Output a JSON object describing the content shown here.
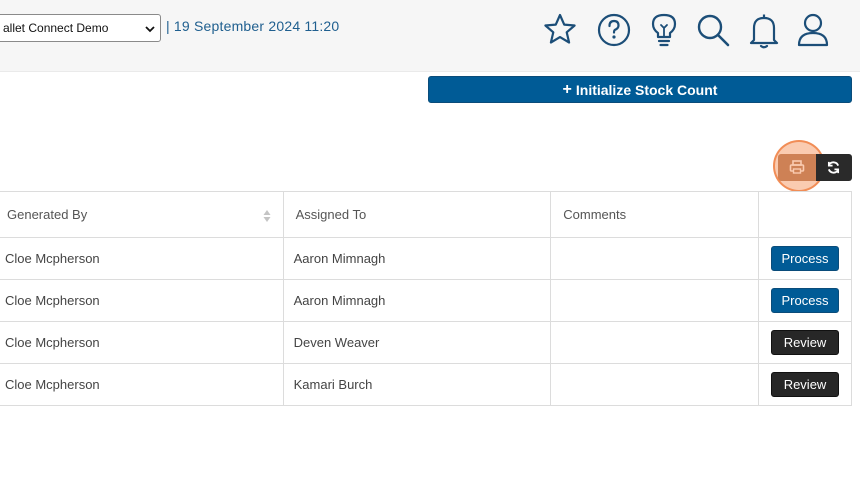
{
  "header": {
    "company_select_value": "allet Connect Demo",
    "datetime": "| 19 September 2024 11:20",
    "icons": [
      "star-icon",
      "help-circle-icon",
      "lightbulb-icon",
      "search-icon",
      "bell-icon",
      "user-icon"
    ]
  },
  "toolbar": {
    "initialize_label": "Initialize Stock Count",
    "print_icon": "print-icon",
    "refresh_icon": "refresh-icon"
  },
  "table": {
    "columns": [
      "Generated By",
      "Assigned To",
      "Comments",
      ""
    ],
    "rows": [
      {
        "generated_by": "Cloe Mcpherson",
        "assigned_to": "Aaron Mimnagh",
        "comments": "",
        "action": "Process"
      },
      {
        "generated_by": "Cloe Mcpherson",
        "assigned_to": "Aaron Mimnagh",
        "comments": "",
        "action": "Process"
      },
      {
        "generated_by": "Cloe Mcpherson",
        "assigned_to": "Deven Weaver",
        "comments": "",
        "action": "Review"
      },
      {
        "generated_by": "Cloe Mcpherson",
        "assigned_to": "Kamari Burch",
        "comments": "",
        "action": "Review"
      }
    ]
  },
  "colors": {
    "primary": "#005b96",
    "dark_button": "#272727",
    "datetime_text": "#1f5f8f",
    "icon_stroke": "#1c4e78",
    "highlight": "#f58c50"
  }
}
